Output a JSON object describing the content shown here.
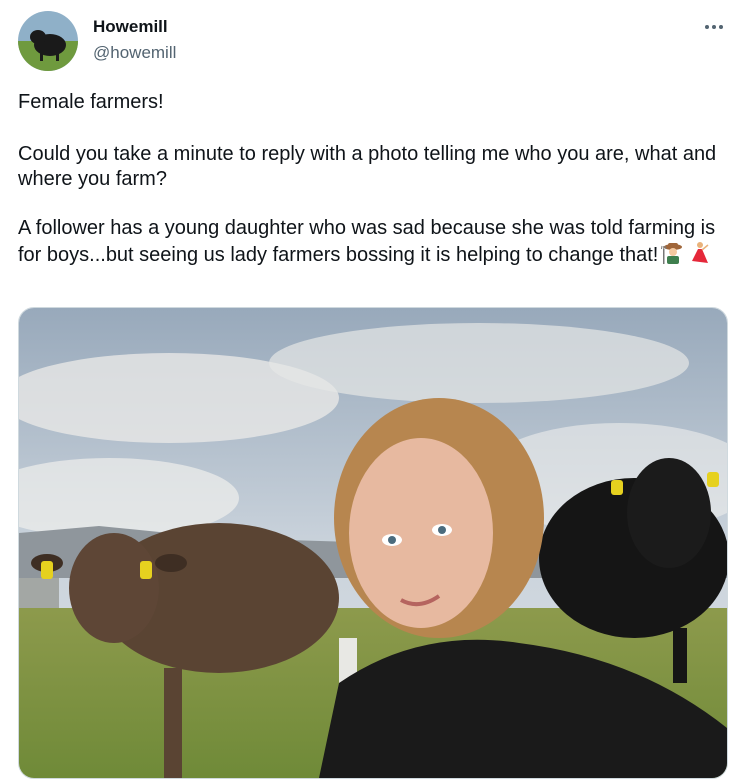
{
  "author": {
    "name": "Howemill",
    "handle": "@howemill",
    "avatar_icon": "cow-avatar-icon"
  },
  "menu": {
    "more_label": "•••"
  },
  "tweet": {
    "paragraphs": [
      "Female farmers!",
      "Could you take a minute to reply with a photo telling me who you are, what and where you farm?",
      "A follower has a young daughter who was sad because she was told farming is for boys...but seeing us lady farmers bossing it is helping to change that!"
    ],
    "emojis": [
      "farmer-emoji",
      "dancer-emoji"
    ]
  },
  "colors": {
    "text": "#0f1419",
    "secondary": "#536471",
    "border": "#cfd9de"
  }
}
